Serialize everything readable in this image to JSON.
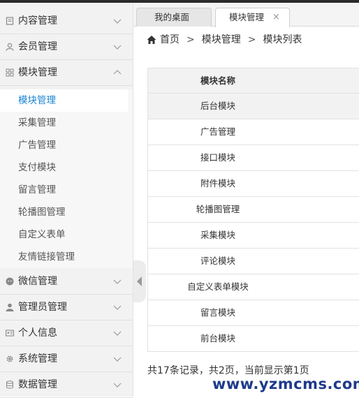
{
  "sidebar": {
    "groups": [
      {
        "label": "内容管理",
        "icon": "document-icon",
        "expanded": false
      },
      {
        "label": "会员管理",
        "icon": "user-icon",
        "expanded": false
      },
      {
        "label": "模块管理",
        "icon": "grid-icon",
        "expanded": true
      },
      {
        "label": "微信管理",
        "icon": "wechat-icon",
        "expanded": false
      },
      {
        "label": "管理员管理",
        "icon": "person-icon",
        "expanded": false
      },
      {
        "label": "个人信息",
        "icon": "id-card-icon",
        "expanded": false
      },
      {
        "label": "系统管理",
        "icon": "gear-icon",
        "expanded": false
      },
      {
        "label": "数据管理",
        "icon": "database-icon",
        "expanded": false
      }
    ],
    "module_items": [
      "模块管理",
      "采集管理",
      "广告管理",
      "支付模块",
      "留言管理",
      "轮播图管理",
      "自定义表单",
      "友情链接管理"
    ],
    "active_item": "模块管理"
  },
  "tabs": [
    {
      "label": "我的桌面",
      "active": false
    },
    {
      "label": "模块管理",
      "active": true,
      "close": "×"
    }
  ],
  "breadcrumb": {
    "home": "首页",
    "level1": "模块管理",
    "level2": "模块列表",
    "separator": ">"
  },
  "table": {
    "header": "模块名称",
    "rows": [
      "后台模块",
      "广告管理",
      "接口模块",
      "附件模块",
      "轮播图管理",
      "采集模块",
      "评论模块",
      "自定义表单模块",
      "留言模块",
      "前台模块"
    ]
  },
  "pagination_info": "共17条记录，共2页，当前显示第1页",
  "watermark": "www.yzmcms.com",
  "colors": {
    "accent": "#1a85d3",
    "sidebar_bg": "#f2f2f2",
    "watermark": "#1e3a8a"
  }
}
